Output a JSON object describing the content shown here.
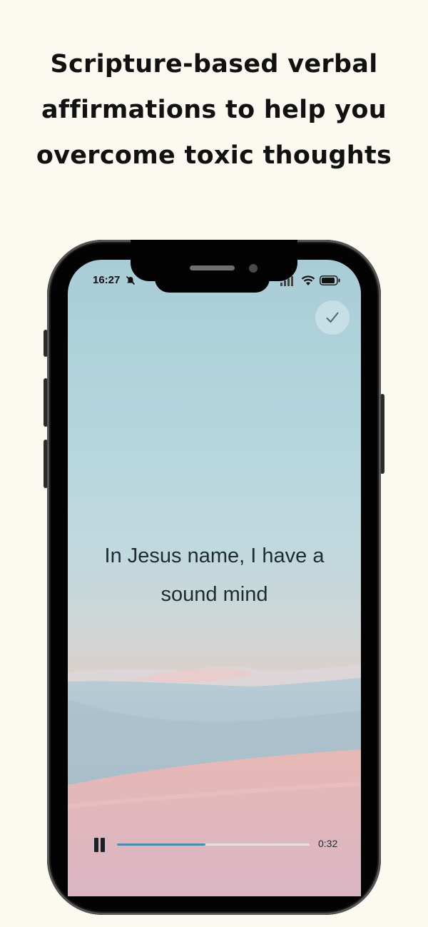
{
  "headline": {
    "line1": "Scripture-based verbal",
    "line2": "affirmations to help you",
    "line3": "overcome toxic thoughts"
  },
  "status_bar": {
    "time": "16:27",
    "icons": [
      "bell-muted-icon",
      "signal-icon",
      "wifi-icon",
      "battery-icon"
    ]
  },
  "check_button": {
    "icon": "checkmark-icon"
  },
  "affirmation": {
    "line1": "In Jesus name, I have a",
    "line2": "sound mind"
  },
  "player": {
    "state_icon": "pause-icon",
    "elapsed": "0:32",
    "progress_fraction": 0.46,
    "accent_color": "#4c8fa8"
  },
  "colors": {
    "background": "#fcf9f1",
    "text": "#111111"
  }
}
